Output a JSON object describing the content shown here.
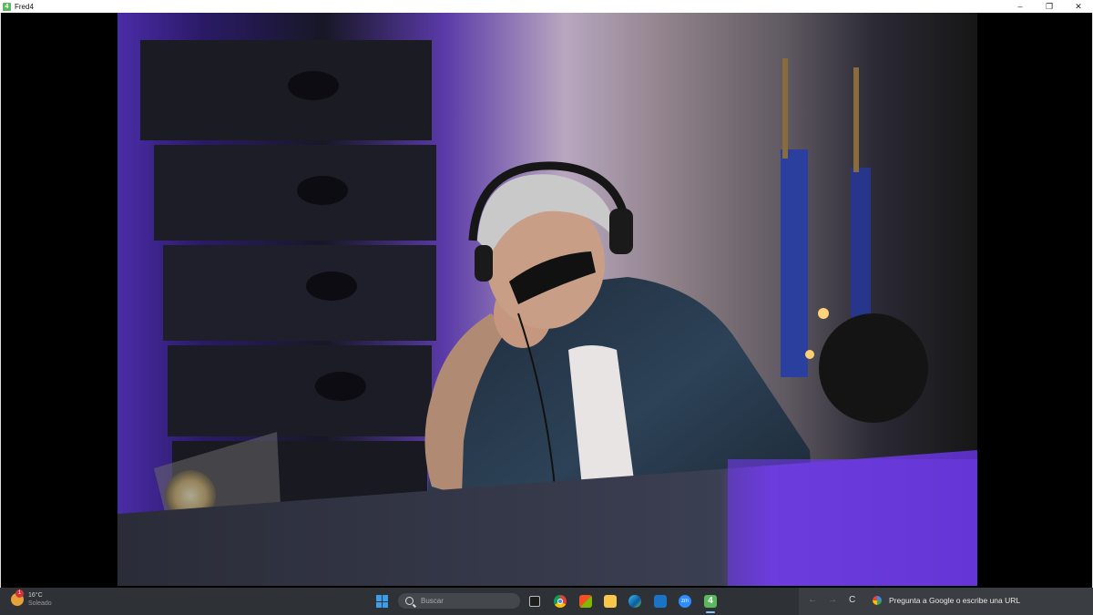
{
  "window": {
    "title": "Fred4",
    "app_icon": "4",
    "controls": {
      "minimize": "–",
      "maximize": "❐",
      "close": "✕"
    }
  },
  "viewer": {
    "image_alt": "Photo of a DJ with grey hair, sunglasses and headphones at a mixing booth under purple stage lights"
  },
  "taskbar": {
    "weather": {
      "badge": "1",
      "temperature": "16°C",
      "condition": "Soleado"
    },
    "search_placeholder": "Buscar",
    "zoom_label": "zm",
    "fred_label": "4",
    "browser": {
      "back": "←",
      "forward": "→",
      "reload": "C",
      "omnibox_placeholder": "Pregunta a Google o escribe una URL"
    }
  },
  "colors": {
    "taskbar_bg": "#2e3236",
    "accent": "#3c9dea",
    "fred_green": "#5cb85c"
  }
}
